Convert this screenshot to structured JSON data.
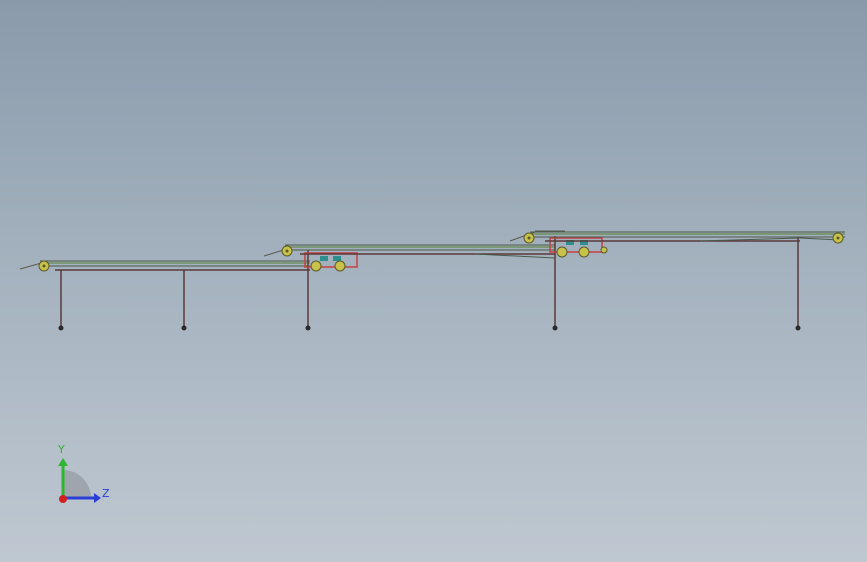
{
  "view": {
    "background_top": "#8a9aab",
    "background_bottom": "#bfc8d1"
  },
  "model": {
    "type": "conveyor-assembly-side-view",
    "frame_color": "#5a3a3a",
    "belt_color": "#6f8f5f",
    "roller_color": "#c9c24a",
    "drive_color": "#2f8f8f",
    "guard_color": "#c84040"
  },
  "triad": {
    "y_label": "Y",
    "z_label": "Z",
    "y_color": "#2fb52f",
    "z_color": "#2b3fd6",
    "x_color": "#d02020",
    "icon": "coordinate-triad-icon"
  }
}
